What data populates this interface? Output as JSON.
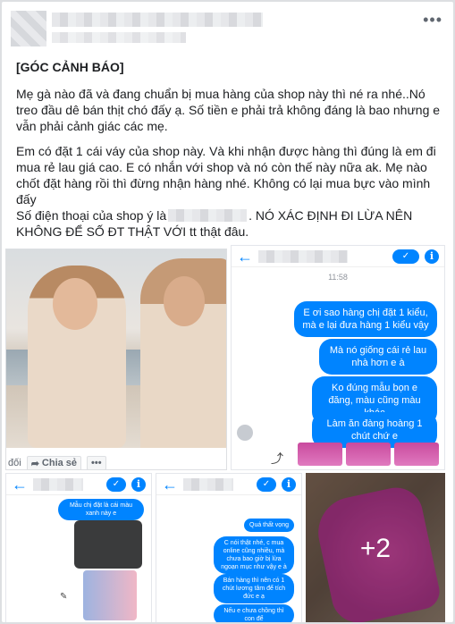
{
  "post": {
    "more_label": "•••",
    "title": "[GÓC CẢNH BÁO]",
    "paragraph1": "Mẹ gà nào đã và đang chuẩn bị mua hàng của shop này thì né ra nhé..Nó treo đầu dê bán thịt chó đấy ạ. Số tiền e phải trả không đáng là bao nhưng e vẫn phải cảnh giác các mẹ.",
    "paragraph2": "Em có đặt 1 cái váy của shop này. Và khi nhận được hàng thì đúng là em đi mua rẻ lau giá cao. E có nhắn với shop và nó còn thế này nữa ak. Mẹ nào chốt đặt hàng rồi thì đừng nhận hàng nhé. Không có lại mua bực vào mình đấy",
    "paragraph3_prefix": "Số điện thoại của shop ý là",
    "paragraph3_suffix": ". NÓ XÁC ĐỊNH ĐI LỪA NÊN KHÔNG ĐỂ SỐ ĐT THẬT VỚI tt thật đâu."
  },
  "shared_post": {
    "action_partial": "đối",
    "share_label": "Chia sẻ",
    "more_label": "•••"
  },
  "chat_main": {
    "timestamp": "11:58",
    "messages": [
      "E ơi sao hàng chị đặt 1 kiểu, mà e lại đưa hàng 1 kiểu vậy",
      "Mà nó giống cái rẻ lau nhà hơn e à",
      "Ko đúng mẫu bọn e đăng, màu cũng màu khác",
      "Làm ăn đàng hoàng 1 chút chứ e"
    ]
  },
  "chat_left": {
    "message": "Mẫu chị đặt là cái màu xanh này e"
  },
  "chat_mid": {
    "messages": [
      "Quá thất vọng",
      "C nói thật nhé, c mua online cũng nhiều, mà chưa bao giờ bị lừa ngoạn mục như vậy e à",
      "Bán hàng thì nên có 1 chút lương tâm để tích đức e ạ",
      "Nếu e chưa chồng thì con để"
    ]
  },
  "gallery": {
    "more_count": "+2"
  },
  "colors": {
    "messenger_blue": "#0084ff",
    "text": "#1c1e21",
    "muted": "#606770"
  }
}
